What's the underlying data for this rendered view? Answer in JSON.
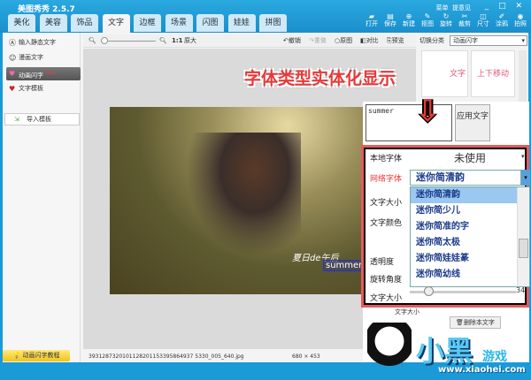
{
  "app": {
    "title": "美图秀秀 2.5.7",
    "menu": "菜单",
    "feedback": "提意见",
    "window_controls": "_ □ ✕"
  },
  "tabs": [
    "美化",
    "美容",
    "饰品",
    "文字",
    "边框",
    "场景",
    "闪图",
    "娃娃",
    "拼图"
  ],
  "active_tab": "文字",
  "tools": [
    {
      "label": "打开",
      "icon": "folder-icon"
    },
    {
      "label": "保存",
      "icon": "save-icon"
    },
    {
      "label": "新建",
      "icon": "new-icon"
    },
    {
      "label": "抠图",
      "icon": "cutout-icon"
    },
    {
      "label": "旋转",
      "icon": "rotate-icon"
    },
    {
      "label": "裁剪",
      "icon": "crop-icon"
    },
    {
      "label": "尺寸",
      "icon": "resize-icon"
    },
    {
      "label": "涂鸦",
      "icon": "brush-icon"
    },
    {
      "label": "拍照",
      "icon": "camera-icon"
    }
  ],
  "sidebar": {
    "items": [
      {
        "label": "输入静态文字"
      },
      {
        "label": "漫画文字"
      },
      {
        "label": "动画闪字",
        "badge": "new"
      },
      {
        "label": "文字模板"
      }
    ],
    "import": "导入模板",
    "tutorial": "动画闪字教程"
  },
  "toolbar": {
    "zoom": "1:1",
    "original_size": "原大",
    "undo": "撤销",
    "redo": "重做",
    "original": "原图",
    "compare": "对比",
    "preview": "预览"
  },
  "status": {
    "filename": "3931287320101128201153395864937 5330_005_640.jpg",
    "dimensions": "680 × 453"
  },
  "canvas": {
    "overlay_text1": "夏日de午后",
    "overlay_text2": "summer"
  },
  "right_panel": {
    "category_label": "切换分类",
    "category_value": "动画闪字",
    "cells": [
      "文字",
      "上下移动"
    ],
    "delete_button": "删除本文字",
    "size_label": "文字大小"
  },
  "editor": {
    "text_value": "summer",
    "apply": "应用文字",
    "local_font_label": "本地字体",
    "local_font_value": "未使用",
    "net_font_label": "网络字体",
    "net_font_value": "迷你简清韵",
    "size_label": "文字大小",
    "color_label": "文字颜色",
    "opacity_label": "透明度",
    "rotation_label": "旋转角度",
    "size_label2": "文字大小",
    "size_value": "34",
    "font_options": [
      "迷你简清韵",
      "迷你简少儿",
      "迷你简准的字",
      "迷你简太极",
      "迷你简娃娃篆",
      "迷你简幼线"
    ]
  },
  "annotation": "字体类型实体化显示",
  "watermark": {
    "name": "小黑",
    "game": "游戏",
    "url": "www.xiaohei.com"
  }
}
